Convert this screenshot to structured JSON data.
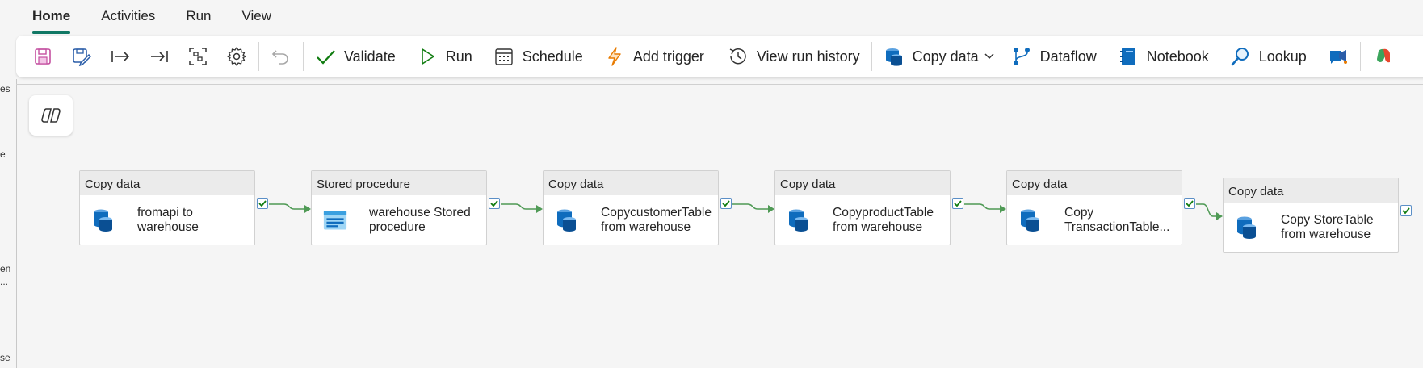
{
  "tabs": [
    {
      "label": "Home",
      "active": true
    },
    {
      "label": "Activities"
    },
    {
      "label": "Run"
    },
    {
      "label": "View"
    }
  ],
  "toolbar": {
    "validate": "Validate",
    "run": "Run",
    "schedule": "Schedule",
    "add_trigger": "Add trigger",
    "view_run_history": "View run history",
    "copy_data": "Copy data",
    "dataflow": "Dataflow",
    "notebook": "Notebook",
    "lookup": "Lookup"
  },
  "leftrail": [
    "es",
    "e",
    "en",
    "...",
    "se"
  ],
  "activities": [
    {
      "type": "Copy data",
      "name": [
        "fromapi to",
        "warehouse"
      ],
      "icon": "database-icon"
    },
    {
      "type": "Stored procedure",
      "name": [
        "warehouse Stored",
        "procedure"
      ],
      "icon": "stored-procedure-icon"
    },
    {
      "type": "Copy data",
      "name": [
        "CopycustomerTable",
        "from warehouse"
      ],
      "icon": "database-icon"
    },
    {
      "type": "Copy data",
      "name": [
        "CopyproductTable",
        "from warehouse"
      ],
      "icon": "database-icon"
    },
    {
      "type": "Copy data",
      "name": [
        "Copy",
        "TransactionTable..."
      ],
      "icon": "database-icon"
    },
    {
      "type": "Copy data",
      "name": [
        "Copy StoreTable",
        "from warehouse"
      ],
      "icon": "database-icon"
    }
  ],
  "colors": {
    "accent": "#117865",
    "success": "#107c10",
    "connector": "#4f9a55",
    "db_blue": "#0f6cbd"
  }
}
